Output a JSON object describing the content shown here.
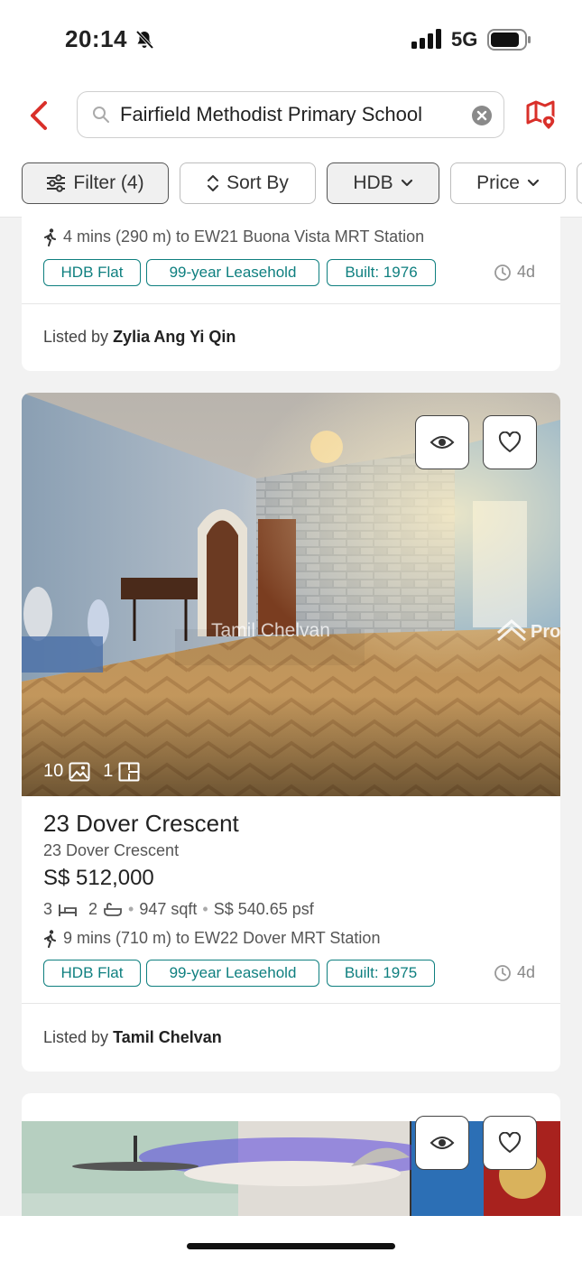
{
  "status_bar": {
    "time": "20:14",
    "network": "5G"
  },
  "search": {
    "query": "Fairfield Methodist Primary School",
    "placeholder": ""
  },
  "filters": [
    {
      "label": "Filter (4)",
      "icon": "sliders-icon"
    },
    {
      "label": "Sort By",
      "icon": "sort-icon"
    },
    {
      "label": "HDB",
      "icon": "chevron-down-icon"
    },
    {
      "label": "Price",
      "icon": "chevron-down-icon"
    }
  ],
  "listings": [
    {
      "mrt": "4 mins (290 m) to EW21 Buona Vista MRT Station",
      "tags": [
        "HDB Flat",
        "99-year Leasehold",
        "Built: 1976"
      ],
      "age": "4d",
      "listed_by_prefix": "Listed by",
      "agent": "Zylia Ang Yi Qin"
    },
    {
      "photo_count": "10",
      "floorplan_count": "1",
      "watermark": "Tamil Chelvan",
      "brand_watermark": "Pro",
      "title": "23 Dover Crescent",
      "address": "23 Dover Crescent",
      "price": "S$ 512,000",
      "beds": "3",
      "baths": "2",
      "size": "947 sqft",
      "psf": "S$ 540.65 psf",
      "mrt": "9 mins (710 m) to EW22 Dover MRT Station",
      "tags": [
        "HDB Flat",
        "99-year Leasehold",
        "Built: 1975"
      ],
      "age": "4d",
      "listed_by_prefix": "Listed by",
      "agent": "Tamil Chelvan"
    }
  ],
  "colors": {
    "accent_red": "#d9302a",
    "tag_teal": "#0e7f7f"
  }
}
